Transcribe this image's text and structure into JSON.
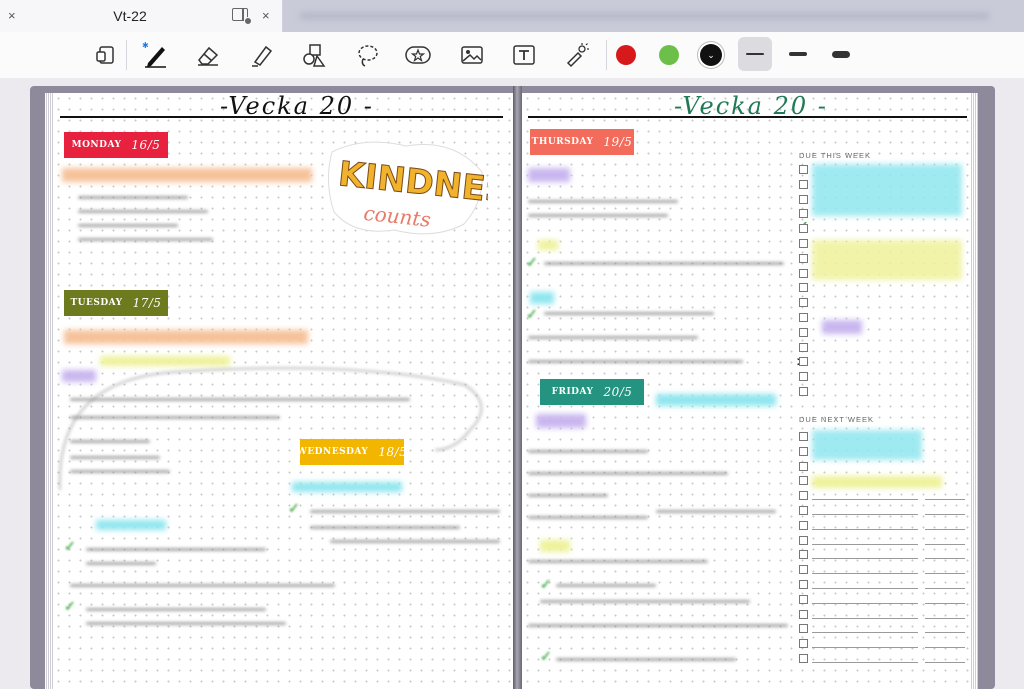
{
  "tab": {
    "title": "Vt-22",
    "close": "×",
    "close2": "×"
  },
  "toolbar": {
    "colors": [
      "#d7191c",
      "#6cc04a",
      "#111111"
    ],
    "tools": [
      "document-icon",
      "pen-icon",
      "eraser-icon",
      "highlighter-icon",
      "shapes-icon",
      "lasso-icon",
      "sticker-icon",
      "image-icon",
      "text-icon",
      "laser-icon"
    ]
  },
  "left_page": {
    "heading": "-Vecka 20 -",
    "days": [
      {
        "name": "MONDAY",
        "date": "16/5",
        "color": "#e8213e"
      },
      {
        "name": "TUESDAY",
        "date": "17/5",
        "color": "#6d7a1e"
      },
      {
        "name": "WEDNESDAY",
        "date": "18/5",
        "color": "#f3b600"
      }
    ],
    "sticker": {
      "line1": "KINDNESS",
      "line2": "counts"
    }
  },
  "right_page": {
    "heading": "-Vecka 20 -",
    "heading_color": "#1f7a55",
    "days": [
      {
        "name": "THURSDAY",
        "date": "19/5",
        "color": "#f36b5a"
      },
      {
        "name": "FRIDAY",
        "date": "20/5",
        "color": "#249481"
      }
    ],
    "due_this_week": "DUE THIS WEEK",
    "due_next_week": "DUE NEXT WEEK"
  }
}
